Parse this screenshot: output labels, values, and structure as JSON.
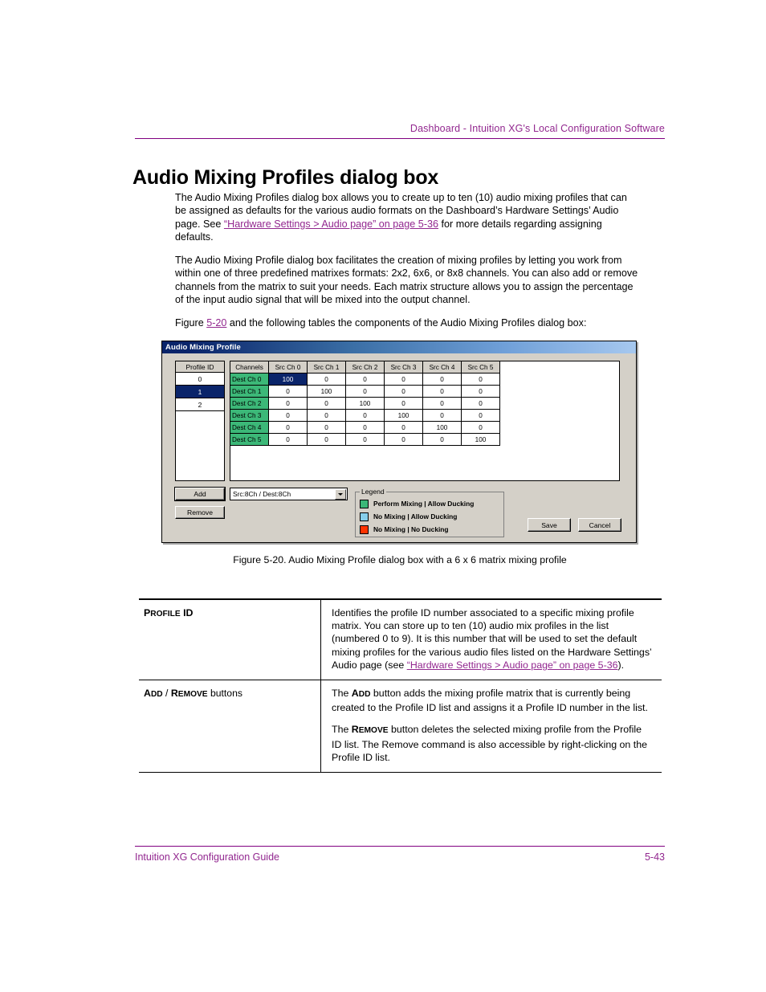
{
  "header": {
    "running_head": "Dashboard - Intuition XG's Local Configuration Software"
  },
  "title": "Audio Mixing Profiles dialog box",
  "paragraphs": {
    "p1_a": "The Audio Mixing Profiles dialog box allows you to create up to ten (10) audio mixing profiles that can be assigned as defaults for the various audio formats on the Dashboard’s Hardware Settings’ Audio page. See ",
    "p1_link": "“Hardware Settings > Audio page” on page 5-36",
    "p1_b": " for more details regarding assigning defaults.",
    "p2": "The Audio Mixing Profile dialog box facilitates the creation of mixing profiles by letting you work from within one of three predefined matrixes formats: 2x2, 6x6, or 8x8 channels. You can also add or remove channels from the matrix to suit your needs. Each matrix structure allows you to assign the percentage of the input audio signal that will be mixed into the output channel.",
    "p3_a": "Figure ",
    "p3_link": "5-20",
    "p3_b": " and the following tables the components of the Audio Mixing Profiles dialog box:"
  },
  "dialog": {
    "title": "Audio Mixing Profile",
    "profile_list": {
      "header": "Profile ID",
      "rows": [
        "0",
        "1",
        "2"
      ],
      "selected_index": 1
    },
    "matrix": {
      "corner_header": "Channels",
      "column_headers": [
        "Src Ch 0",
        "Src Ch 1",
        "Src Ch 2",
        "Src Ch 3",
        "Src Ch 4",
        "Src Ch 5"
      ],
      "row_headers": [
        "Dest Ch 0",
        "Dest Ch 1",
        "Dest Ch 2",
        "Dest Ch 3",
        "Dest Ch 4",
        "Dest Ch 5"
      ],
      "values": [
        [
          "100",
          "0",
          "0",
          "0",
          "0",
          "0"
        ],
        [
          "0",
          "100",
          "0",
          "0",
          "0",
          "0"
        ],
        [
          "0",
          "0",
          "100",
          "0",
          "0",
          "0"
        ],
        [
          "0",
          "0",
          "0",
          "100",
          "0",
          "0"
        ],
        [
          "0",
          "0",
          "0",
          "0",
          "100",
          "0"
        ],
        [
          "0",
          "0",
          "0",
          "0",
          "0",
          "100"
        ]
      ],
      "selected_cell": {
        "row": 0,
        "col": 0
      }
    },
    "buttons": {
      "add": "Add",
      "remove": "Remove",
      "save": "Save",
      "cancel": "Cancel"
    },
    "format_select": {
      "value": "Src:8Ch / Dest:8Ch"
    },
    "legend": {
      "title": "Legend",
      "items": [
        {
          "label": "Perform Mixing | Allow Ducking",
          "color": "#3cb878"
        },
        {
          "label": "No Mixing | Allow Ducking",
          "color": "#87ceeb"
        },
        {
          "label": "No Mixing | No Ducking",
          "color": "#ff3300"
        }
      ]
    },
    "colors": {
      "titlebar_start": "#0a246a",
      "titlebar_end": "#a6c8ef",
      "face": "#d4d0c8",
      "selection": "#0a246a",
      "dest_cell": "#3cb878"
    }
  },
  "figure_caption": "Figure 5-20. Audio Mixing Profile dialog box with a 6 x 6 matrix mixing profile",
  "def_table": {
    "row1": {
      "term_cap": "P",
      "term_small": "ROFILE",
      "term_cap2": " ID",
      "desc_a": "Identifies the profile ID number associated to a specific mixing profile matrix. You can store up to ten (10) audio mix profiles in the list (numbered 0 to 9). It is this number that will be used to set the default mixing profiles for the various audio files listed on the Hardware Settings’ Audio page (see ",
      "desc_link": "“Hardware Settings > Audio page” on page 5-36",
      "desc_b": ")."
    },
    "row2": {
      "term_a_cap": "A",
      "term_a_small": "DD",
      "term_sep": " / ",
      "term_b_cap": "R",
      "term_b_small": "EMOVE",
      "term_tail": " buttons",
      "p1_a": "The ",
      "p1_kw_cap": "A",
      "p1_kw_small": "DD",
      "p1_b": " button adds the mixing profile matrix that is currently being created to the Profile ID list and assigns it a Profile ID number in the list.",
      "p2_a": "The ",
      "p2_kw_cap": "R",
      "p2_kw_small": "EMOVE",
      "p2_b": " button deletes the selected mixing profile from the Profile ID list. The Remove command is also accessible by right-clicking on the Profile ID list."
    }
  },
  "footer": {
    "left": "Intuition XG Configuration Guide",
    "right": "5-43"
  }
}
